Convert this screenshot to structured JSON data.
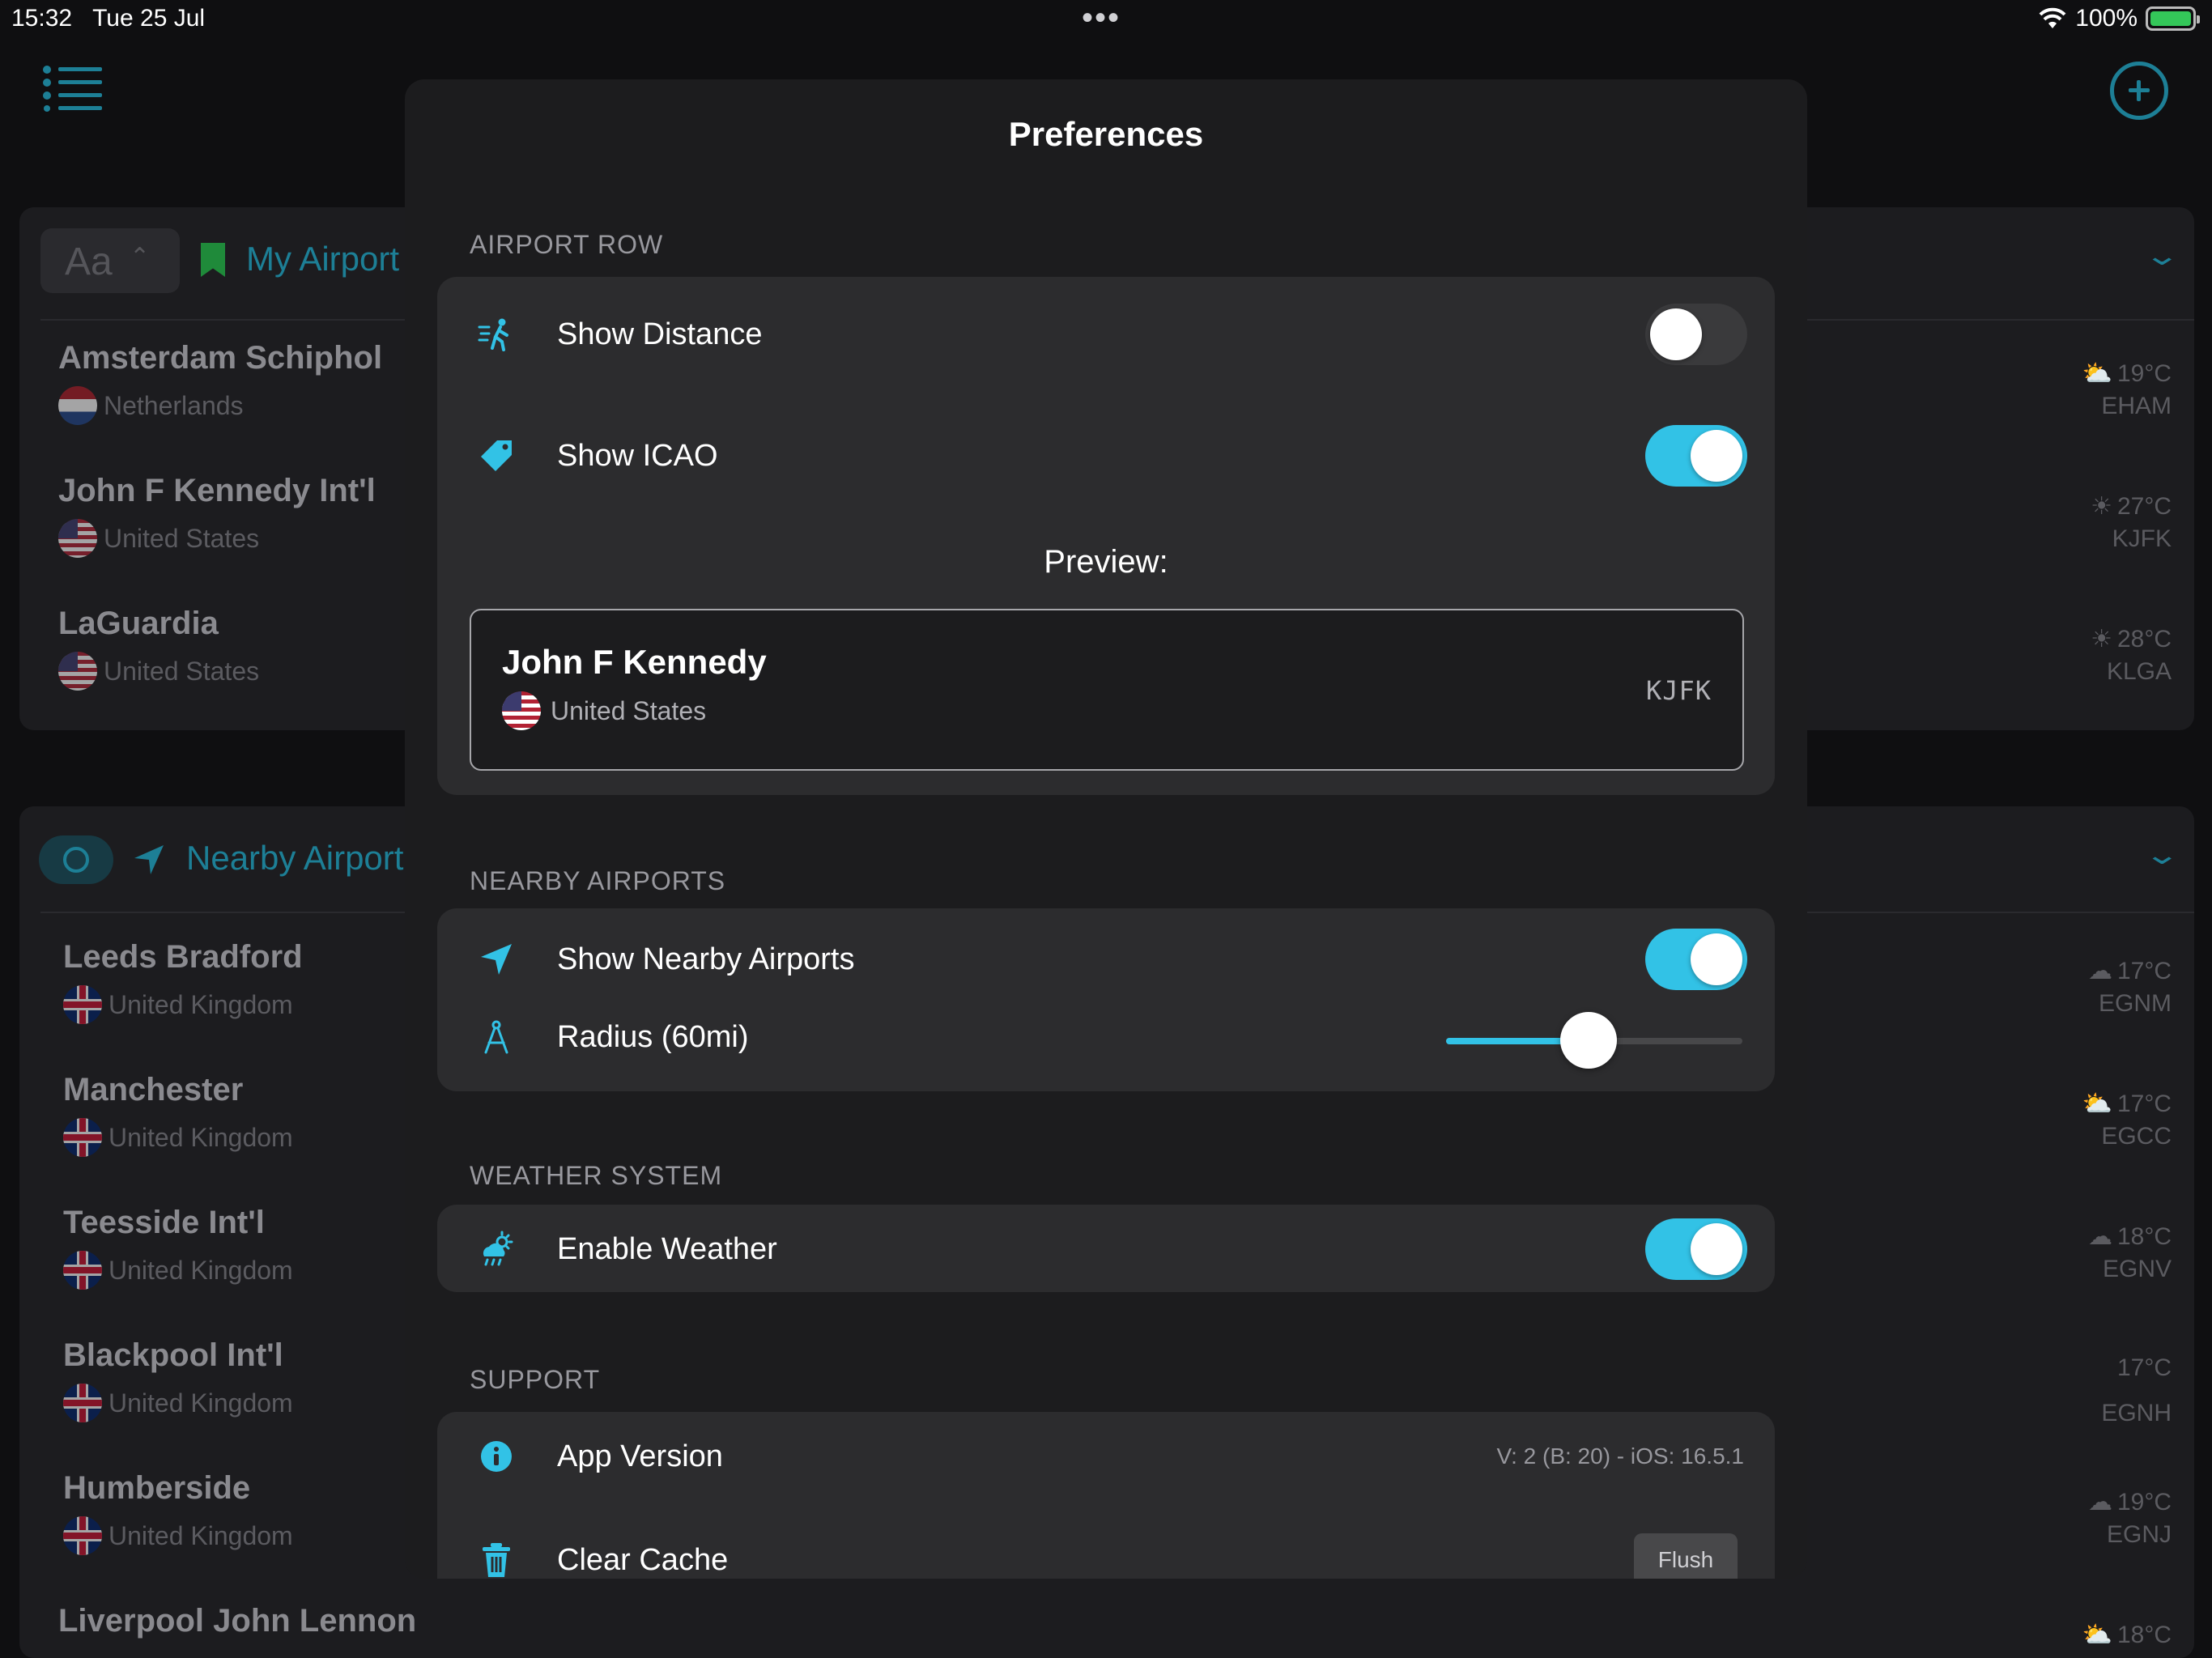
{
  "status_bar": {
    "time": "15:32",
    "date": "Tue 25 Jul",
    "dots": "•••",
    "battery": "100%",
    "wifi_icon": "wifi-icon"
  },
  "background": {
    "my_airports": {
      "title": "My Airport",
      "sort_label": "Aa",
      "rows": [
        {
          "name": "Amsterdam Schiphol",
          "country": "Netherlands",
          "flag": "nl",
          "temp": "19°C",
          "icao": "EHAM",
          "weather": "partly-cloudy"
        },
        {
          "name": "John F Kennedy Int'l",
          "country": "United States",
          "flag": "us",
          "temp": "27°C",
          "icao": "KJFK",
          "weather": "sunny"
        },
        {
          "name": "LaGuardia",
          "country": "United States",
          "flag": "us",
          "temp": "28°C",
          "icao": "KLGA",
          "weather": "sunny"
        }
      ]
    },
    "nearby_airports": {
      "title": "Nearby Airport",
      "rows": [
        {
          "name": "Leeds Bradford",
          "country": "United Kingdom",
          "flag": "uk",
          "temp": "17°C",
          "icao": "EGNM",
          "weather": "rain"
        },
        {
          "name": "Manchester",
          "country": "United Kingdom",
          "flag": "uk",
          "temp": "17°C",
          "icao": "EGCC",
          "weather": "partly-cloudy"
        },
        {
          "name": "Teesside Int'l",
          "country": "United Kingdom",
          "flag": "uk",
          "temp": "18°C",
          "icao": "EGNV",
          "weather": "cloudy"
        },
        {
          "name": "Blackpool Int'l",
          "country": "United Kingdom",
          "flag": "uk",
          "temp": "17°C",
          "icao": "EGNH",
          "weather": "none"
        },
        {
          "name": "Humberside",
          "country": "United Kingdom",
          "flag": "uk",
          "temp": "19°C",
          "icao": "EGNJ",
          "weather": "cloudy"
        },
        {
          "name": "Liverpool John Lennon",
          "country": "",
          "flag": "uk",
          "temp": "18°C",
          "icao": "",
          "weather": "partly-cloudy"
        }
      ]
    }
  },
  "modal": {
    "title": "Preferences",
    "airport_row": {
      "section_label": "AIRPORT ROW",
      "show_distance": {
        "label": "Show Distance",
        "on": false
      },
      "show_icao": {
        "label": "Show ICAO",
        "on": true
      },
      "preview_label": "Preview:",
      "preview": {
        "name": "John F Kennedy",
        "country": "United States",
        "icao": "KJFK"
      }
    },
    "nearby_airports": {
      "section_label": "NEARBY AIRPORTS",
      "show_nearby": {
        "label": "Show Nearby Airports",
        "on": true
      },
      "radius": {
        "label": "Radius (60mi)",
        "value_fraction": 0.48
      }
    },
    "weather_system": {
      "section_label": "WEATHER SYSTEM",
      "enable_weather": {
        "label": "Enable Weather",
        "on": true
      }
    },
    "support": {
      "section_label": "SUPPORT",
      "app_version": {
        "label": "App Version",
        "value": "V: 2 (B: 20) - iOS: 16.5.1"
      },
      "clear_cache": {
        "label": "Clear Cache",
        "button": "Flush"
      }
    }
  },
  "colors": {
    "accent": "#32c2e6",
    "bg": "#0f0f11",
    "modal_bg": "#1c1c1e",
    "group_bg": "#2c2c2e",
    "dim_accent": "#1d7f96"
  }
}
